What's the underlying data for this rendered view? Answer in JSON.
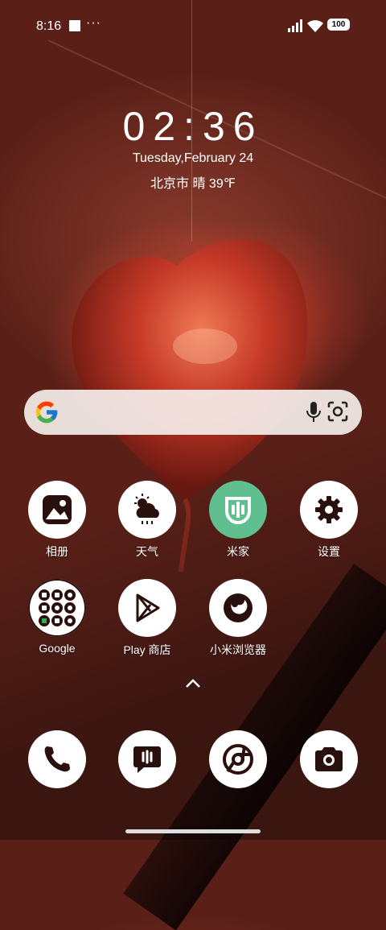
{
  "status_bar": {
    "time": "8:16",
    "dots": "···",
    "battery": "100"
  },
  "lock_widget": {
    "clock": "02:36",
    "date": "Tuesday,February 24",
    "weather": "北京市 晴 39℉"
  },
  "search_bar": {
    "icons": [
      "google-logo-icon",
      "mic-icon",
      "lens-icon"
    ]
  },
  "apps_row1": [
    {
      "label": "相册",
      "icon": "gallery-icon"
    },
    {
      "label": "天气",
      "icon": "weather-icon"
    },
    {
      "label": "米家",
      "icon": "mijia-icon"
    },
    {
      "label": "设置",
      "icon": "settings-icon"
    }
  ],
  "apps_row2": [
    {
      "label": "Google",
      "icon": "google-folder-icon"
    },
    {
      "label": "Play 商店",
      "icon": "play-store-icon"
    },
    {
      "label": "小米浏览器",
      "icon": "browser-icon"
    }
  ],
  "dock": [
    {
      "icon": "phone-icon"
    },
    {
      "icon": "messages-icon"
    },
    {
      "icon": "chrome-icon"
    },
    {
      "icon": "camera-icon"
    }
  ],
  "colors": {
    "mijia_green": "#5fbf8e",
    "icon_fg": "#2a100c"
  }
}
